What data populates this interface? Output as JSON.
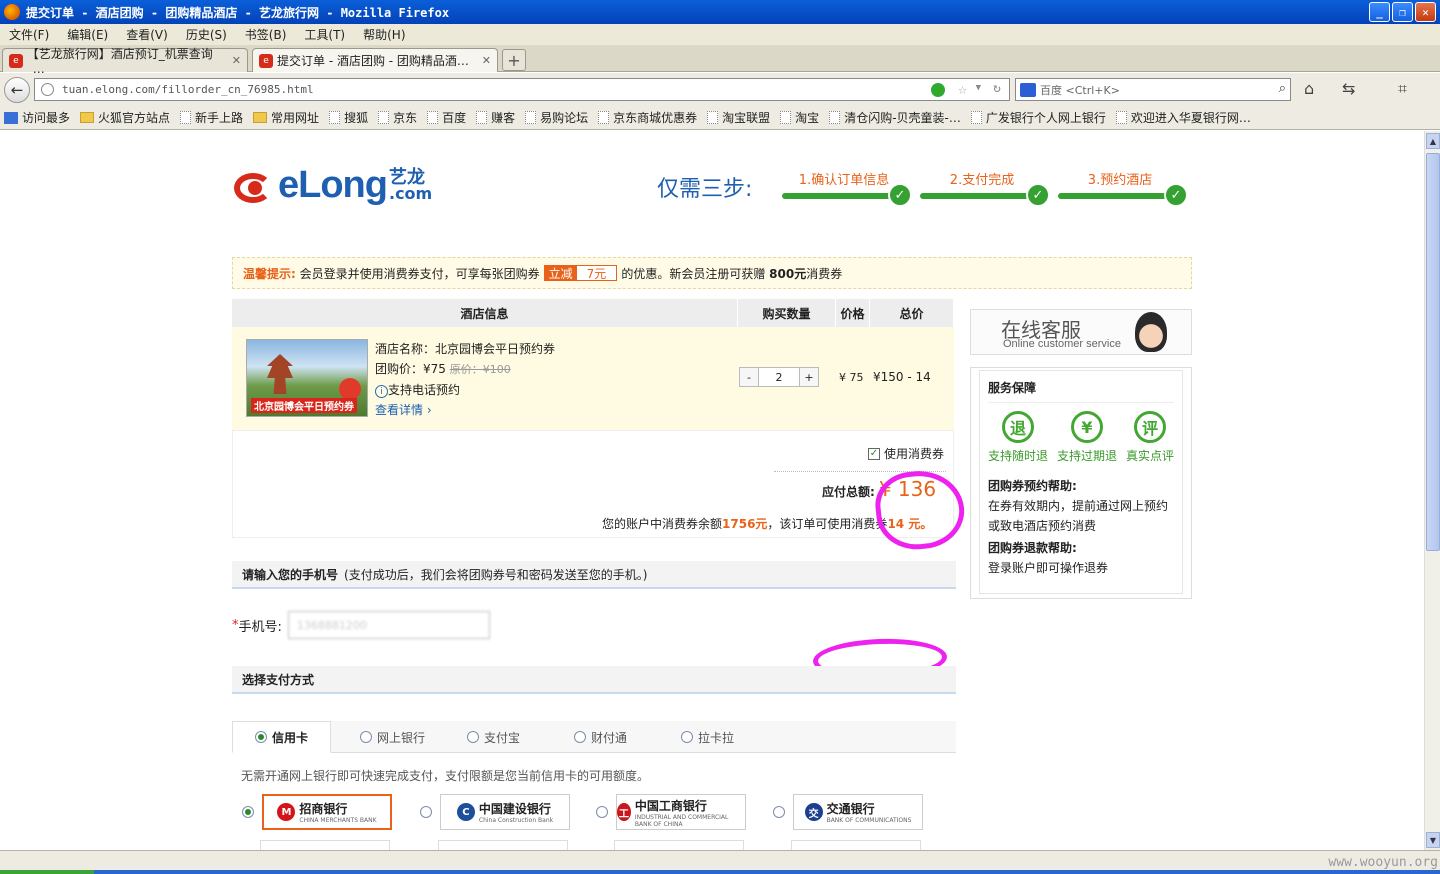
{
  "window": {
    "title": "提交订单 - 酒店团购 - 团购精品酒店 - 艺龙旅行网 - Mozilla Firefox"
  },
  "menu": [
    "文件(F)",
    "编辑(E)",
    "查看(V)",
    "历史(S)",
    "书签(B)",
    "工具(T)",
    "帮助(H)"
  ],
  "tabs": [
    {
      "label": "【艺龙旅行网】酒店预订_机票查询_…"
    },
    {
      "label": "提交订单 - 酒店团购 - 团购精品酒…"
    }
  ],
  "url": "tuan.elong.com/fillorder_cn_76985.html",
  "search": {
    "placeholder": "百度 <Ctrl+K>"
  },
  "bookmarks": [
    "访问最多",
    "火狐官方站点",
    "新手上路",
    "常用网址",
    "搜狐",
    "京东",
    "百度",
    "赚客",
    "易购论坛",
    "京东商城优惠券",
    "淘宝联盟",
    "淘宝",
    "清仓闪购-贝壳童装-…",
    "广发银行个人网上银行",
    "欢迎进入华夏银行网…"
  ],
  "logo": {
    "word": "eLong",
    "cn_top": "艺龙",
    "cn_bottom": ".com"
  },
  "steps": {
    "title": "仅需三步:",
    "items": [
      "1.确认订单信息",
      "2.支付完成",
      "3.预约酒店"
    ]
  },
  "tip": {
    "label": "温馨提示:",
    "text1": "会员登录并使用消费券支付，可享每张团购券",
    "badge_a": "立减",
    "badge_b": "7元",
    "text2": "的优惠。新会员注册可获赠",
    "bold": "800元",
    "text3": "消费券"
  },
  "table": {
    "headers": [
      "酒店信息",
      "购买数量",
      "价格",
      "总价"
    ]
  },
  "order": {
    "name": "酒店名称：北京园博会平日预约券",
    "price_label": "团购价：¥75",
    "orig": "原价：¥100",
    "phone": "支持电话预约",
    "details": "查看详情",
    "image_caption": "北京园博会平日预约券",
    "qty": "2",
    "minus": "-",
    "plus": "+",
    "unit": "¥ 75",
    "total": "¥150 - 14"
  },
  "use_coupon": "使用消费券",
  "pay_total": {
    "label": "应付总额:",
    "amount": "¥ 136"
  },
  "balance": {
    "pre": "您的账户中消费券余额",
    "amt": "1756元",
    "mid": "，该订单可使用消费券",
    "use": "14 元",
    "end": "。"
  },
  "phone_section": {
    "title": "请输入您的手机号",
    "note": "(支付成功后，我们会将团购券号和密码发送至您的手机。)",
    "label": "手机号:",
    "value": "1368881200"
  },
  "pay_section": {
    "title": "选择支付方式",
    "tabs": [
      "信用卡",
      "网上银行",
      "支付宝",
      "财付通",
      "拉卡拉"
    ],
    "note": "无需开通网上银行即可快速完成支付，支付限额是您当前信用卡的可用额度。"
  },
  "banks": [
    {
      "name": "招商银行",
      "en": "CHINA MERCHANTS BANK",
      "color": "#d4141a"
    },
    {
      "name": "中国建设银行",
      "en": "China Construction Bank",
      "color": "#1d4f9a"
    },
    {
      "name": "中国工商银行",
      "en": "INDUSTRIAL AND COMMERCIAL BANK OF CHINA",
      "color": "#c8161d"
    },
    {
      "name": "交通银行",
      "en": "BANK OF COMMUNICATIONS",
      "color": "#1d3f8f"
    }
  ],
  "cs": {
    "title": "在线客服",
    "sub": "Online customer service"
  },
  "service": {
    "title": "服务保障",
    "icons": [
      {
        "glyph": "退",
        "label": "支持随时退"
      },
      {
        "glyph": "¥",
        "label": "支持过期退"
      },
      {
        "glyph": "评",
        "label": "真实点评"
      }
    ],
    "help1_title": "团购券预约帮助:",
    "help1": "在券有效期内，提前通过网上预约或致电酒店预约消费",
    "help2_title": "团购券退款帮助:",
    "help2": "登录账户即可操作退券"
  },
  "watermark": "www.wooyun.org"
}
